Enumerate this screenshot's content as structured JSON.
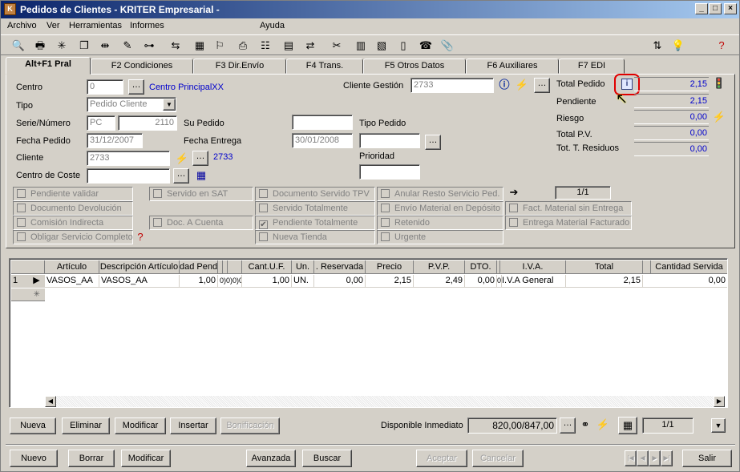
{
  "window": {
    "title": "Pedidos de Clientes - KRITER Empresarial -"
  },
  "menu": [
    "Archivo",
    "Ver",
    "Herramientas",
    "Informes",
    "Ayuda"
  ],
  "tabs": [
    "Alt+F1 Pral",
    "F2 Condiciones",
    "F3 Dir.Envío",
    "F4 Trans.",
    "F5 Otros Datos",
    "F6 Auxiliares",
    "F7 EDI"
  ],
  "form": {
    "centro_label": "Centro",
    "centro_value": "0",
    "centro_link": "Centro PrincipalXX",
    "tipo_label": "Tipo",
    "tipo_value": "Pedido Cliente",
    "serie_label": "Serie/Número",
    "serie_value": "PC",
    "numero_value": "2110",
    "su_pedido_label": "Su Pedido",
    "su_pedido_value": "",
    "fecha_pedido_label": "Fecha Pedido",
    "fecha_pedido_value": "31/12/2007",
    "fecha_entrega_label": "Fecha Entrega",
    "fecha_entrega_value": "30/01/2008",
    "cliente_label": "Cliente",
    "cliente_value": "2733",
    "cliente_link": "2733",
    "centro_coste_label": "Centro de Coste",
    "centro_coste_value": "",
    "cliente_gestion_label": "Cliente Gestión",
    "cliente_gestion_value": "2733",
    "tipo_pedido_label": "Tipo Pedido",
    "tipo_pedido_value": "",
    "prioridad_label": "Prioridad",
    "prioridad_value": ""
  },
  "totals": {
    "total_pedido_label": "Total Pedido",
    "total_pedido": "2,15",
    "pendiente_label": "Pendiente",
    "pendiente": "2,15",
    "riesgo_label": "Riesgo",
    "riesgo": "0,00",
    "total_pv_label": "Total P.V.",
    "total_pv": "0,00",
    "residuos_label": "Tot. T. Residuos",
    "residuos": "0,00"
  },
  "record_counter": "1/1",
  "checks": {
    "pendiente_validar": "Pendiente validar",
    "documento_devolucion": "Documento Devolución",
    "comision_indirecta": "Comisión Indirecta",
    "obligar_servicio": "Obligar Servicio Completo",
    "servido_sat": "Servido en SAT",
    "doc_a_cuenta": "Doc. A Cuenta",
    "documento_servido_tpv": "Documento Servido TPV",
    "servido_totalmente": "Servido Totalmente",
    "pendiente_totalmente": "Pendiente Totalmente",
    "nueva_tienda": "Nueva Tienda",
    "anular_resto": "Anular Resto Servicio Ped.",
    "envio_material": "Envío Material en Depósito",
    "retenido": "Retenido",
    "urgente": "Urgente",
    "fact_material": "Fact. Material sin Entrega",
    "entrega_material": "Entrega Material Facturado"
  },
  "grid": {
    "headers": [
      "Artículo",
      "Descripción Artículo",
      "dad Pend",
      "",
      "",
      "",
      "Cant.U.F.",
      "Un.",
      ". Reservada",
      "Precio",
      "P.V.P.",
      "DTO.",
      "",
      "I.V.A.",
      "Total",
      "",
      "Cantidad Servida"
    ],
    "row": {
      "num": "1",
      "articulo": "VASOS_AA",
      "descripcion": "VASOS_AA",
      "cant_pend": "1,00",
      "extra": "0)0)0)0)",
      "cant_uf": "1,00",
      "un": "UN.",
      "reservada": "0,00",
      "precio": "2,15",
      "pvp": "2,49",
      "dto": "0,00",
      "dto_extra": "0",
      "iva": "I.V.A General",
      "total": "2,15",
      "servida": "0,00"
    }
  },
  "line_buttons": [
    "Nueva",
    "Eliminar",
    "Modificar",
    "Insertar",
    "Bonificación"
  ],
  "disponible": {
    "label": "Disponible Inmediato",
    "value": "820,00/847,00"
  },
  "grid_counter": "1/1",
  "bottom_buttons": [
    "Nuevo",
    "Borrar",
    "Modificar",
    "Avanzada",
    "Buscar",
    "Aceptar",
    "Cancelar",
    "Salir"
  ]
}
